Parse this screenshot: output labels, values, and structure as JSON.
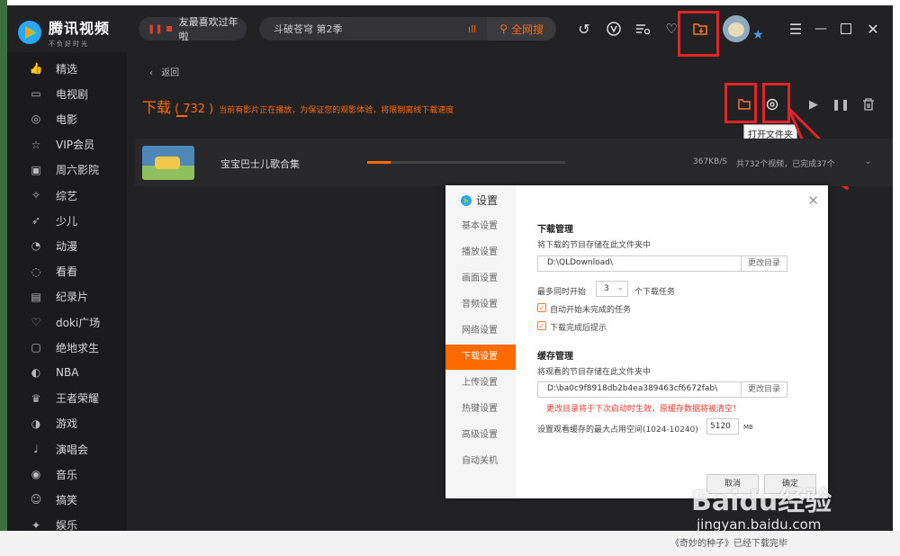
{
  "app": {
    "logo_title": "腾讯视频",
    "logo_sub": "不负好时光",
    "now_playing": "友最喜欢过年啦",
    "search_value": "斗破苍穹 第2季",
    "search_button": "全网搜"
  },
  "sidebar": {
    "items": [
      {
        "label": "精选",
        "icon": "thumbs-up-icon"
      },
      {
        "label": "电视剧",
        "icon": "tv-icon"
      },
      {
        "label": "电影",
        "icon": "film-reel-icon"
      },
      {
        "label": "VIP会员",
        "icon": "star-outline-icon"
      },
      {
        "label": "周六影院",
        "icon": "theater-icon"
      },
      {
        "label": "综艺",
        "icon": "magic-wand-icon"
      },
      {
        "label": "少儿",
        "icon": "rocket-icon"
      },
      {
        "label": "动漫",
        "icon": "cat-face-icon"
      },
      {
        "label": "看看",
        "icon": "location-icon"
      },
      {
        "label": "纪录片",
        "icon": "film-strip-icon"
      },
      {
        "label": "doki广场",
        "icon": "heart-outline-icon"
      },
      {
        "label": "绝地求生",
        "icon": "game-card-icon"
      },
      {
        "label": "NBA",
        "icon": "basketball-player-icon"
      },
      {
        "label": "王者荣耀",
        "icon": "crown-icon"
      },
      {
        "label": "游戏",
        "icon": "controller-icon"
      },
      {
        "label": "演唱会",
        "icon": "microphone-icon"
      },
      {
        "label": "音乐",
        "icon": "music-disc-icon"
      },
      {
        "label": "搞笑",
        "icon": "smile-icon"
      },
      {
        "label": "娱乐",
        "icon": "sparkle-icon"
      }
    ]
  },
  "page": {
    "back_label": "返回",
    "title": "下载",
    "count": "( 732 )",
    "notice": "当前有影片正在播放，为保证您的观影体验，将限制离线下载速度",
    "tooltip": "打开文件夹"
  },
  "download": {
    "name": "宝宝巴士儿歌合集",
    "speed": "367KB/S",
    "status": "共732个视频，已完成37个",
    "progress": 0.12
  },
  "dialog": {
    "title": "设置",
    "tabs": [
      "基本设置",
      "播放设置",
      "画面设置",
      "音频设置",
      "网络设置",
      "下载设置",
      "上传设置",
      "热键设置",
      "高级设置",
      "自动关机"
    ],
    "active_tab_index": 5,
    "download_section": {
      "title": "下载管理",
      "desc": "将下载的节目存储在此文件夹中",
      "path": "D:\\QLDownload\\",
      "change_button": "更改目录",
      "concurrent_prefix": "最多同时开始",
      "concurrent_value": "3",
      "concurrent_suffix": "个下载任务",
      "auto_start": "自动开始未完成的任务",
      "notify_done": "下载完成后提示"
    },
    "cache_section": {
      "title": "缓存管理",
      "desc": "将观看的节目存储在此文件夹中",
      "path": "D:\\ba0c9f8918db2b4ea389463cf6672fab\\",
      "change_button": "更改目录",
      "warning": "更改目录将于下次启动时生效，原缓存数据将被清空！",
      "max_label": "设置观看缓存的最大占用空间(1024-10240)",
      "max_value": "5120",
      "unit": "MB"
    },
    "cancel_button": "取消",
    "ok_button": "确定"
  },
  "watermark": {
    "brand": "Baidu经验",
    "url": "jingyan.baidu.com"
  },
  "background": {
    "notification": "《奇妙的种子》已经下载完毕"
  },
  "colors": {
    "accent": "#ff6a00",
    "highlight_box": "#e2232a",
    "dark_bg": "#222225"
  }
}
